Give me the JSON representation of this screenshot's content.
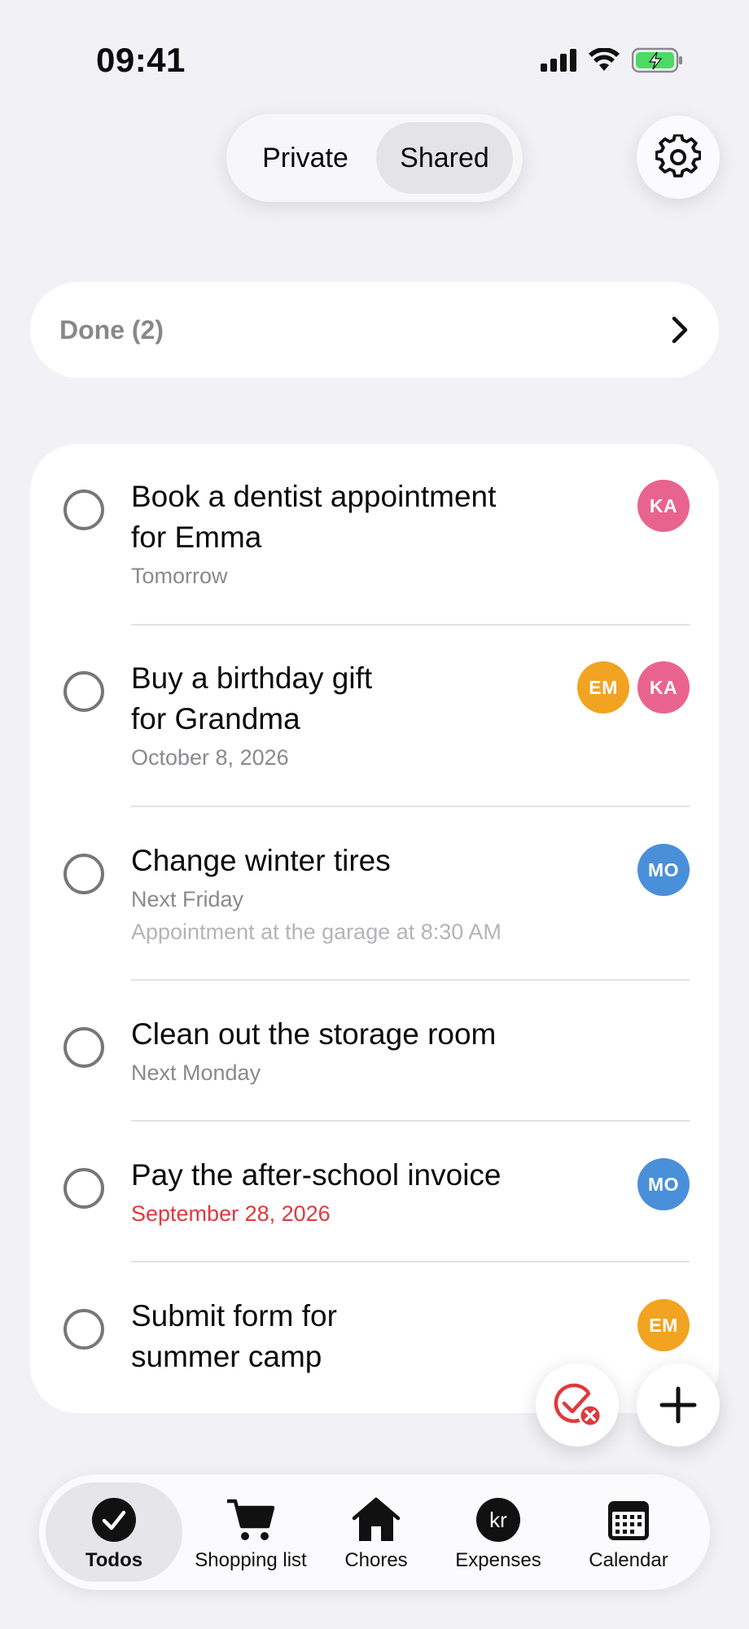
{
  "status_bar": {
    "time": "09:41"
  },
  "segmented": {
    "private_label": "Private",
    "shared_label": "Shared",
    "selected": "Shared"
  },
  "done": {
    "label": "Done (2)"
  },
  "todos": [
    {
      "title": "Book a dentist appointment\nfor Emma",
      "date": "Tomorrow",
      "note": "",
      "overdue": false,
      "assignees": [
        "KA"
      ]
    },
    {
      "title": "Buy a birthday gift\nfor Grandma",
      "date": "October 8, 2026",
      "note": "",
      "overdue": false,
      "assignees": [
        "EM",
        "KA"
      ]
    },
    {
      "title": "Change winter tires",
      "date": "Next Friday",
      "note": "Appointment at the garage at 8:30 AM",
      "overdue": false,
      "assignees": [
        "MO"
      ]
    },
    {
      "title": "Clean out the storage room",
      "date": "Next Monday",
      "note": "",
      "overdue": false,
      "assignees": []
    },
    {
      "title": "Pay the after-school invoice",
      "date": "September 28, 2026",
      "note": "",
      "overdue": true,
      "assignees": [
        "MO"
      ]
    },
    {
      "title": "Submit form for\nsummer camp",
      "date": "",
      "note": "",
      "overdue": false,
      "assignees": [
        "EM"
      ]
    }
  ],
  "avatar_colors": {
    "KA": "#e8648f",
    "EM": "#f2a321",
    "MO": "#4a8fd9"
  },
  "tabs": [
    {
      "label": "Todos",
      "icon": "check-circle-icon",
      "active": true
    },
    {
      "label": "Shopping list",
      "icon": "cart-icon",
      "active": false
    },
    {
      "label": "Chores",
      "icon": "house-icon",
      "active": false
    },
    {
      "label": "Expenses",
      "icon": "kr-coin-icon",
      "active": false,
      "icon_text": "kr"
    },
    {
      "label": "Calendar",
      "icon": "calendar-icon",
      "active": false
    }
  ],
  "colors": {
    "overdue": "#e0393d",
    "background": "#f1f1f6"
  }
}
